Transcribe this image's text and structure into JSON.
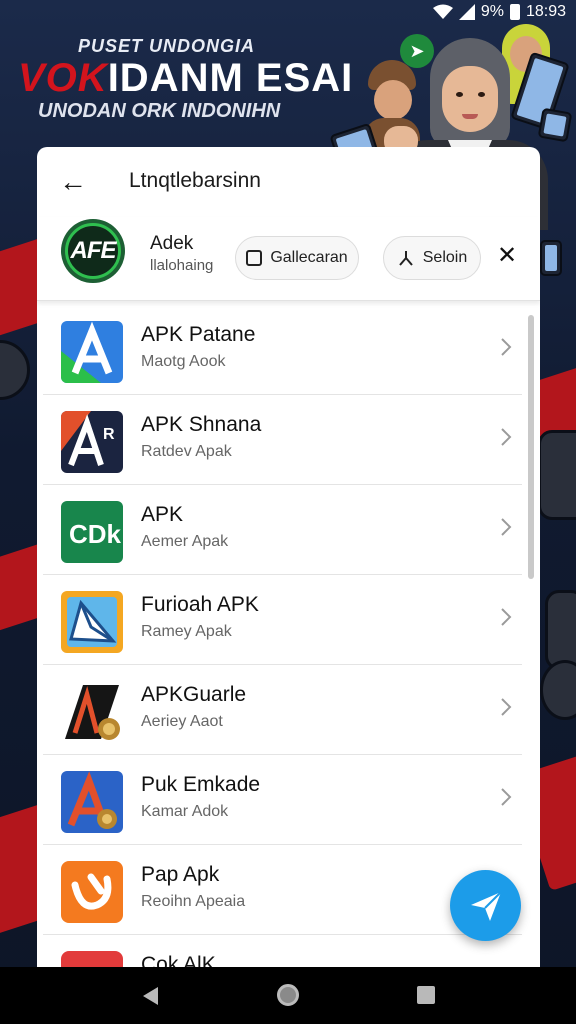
{
  "status": {
    "battery": "9%",
    "time": "18:93"
  },
  "banner": {
    "line1": "PUSET UNDONGIA",
    "line2_red": "VOK",
    "line2_white": "IDANM ESAI",
    "line3": "UNODAN ORK INDONIHN"
  },
  "header": {
    "title": "Ltnqtlebarsinn"
  },
  "app": {
    "logo_text": "AFE",
    "name": "Adek",
    "subtitle": "llalohaing",
    "button1_label": "Gallecaran",
    "button2_label": "Seloin"
  },
  "list": [
    {
      "title": "APK  Patane",
      "subtitle": "Maotg Aook",
      "icon": "apk-a-green-icon"
    },
    {
      "title": "APK  Shnana",
      "subtitle": "Ratdev Apak",
      "icon": "apk-ak-dark-icon"
    },
    {
      "title": "APK",
      "subtitle": "Aemer Apak",
      "icon": "apk-cdk-green-icon"
    },
    {
      "title": "Furioah APK",
      "subtitle": "Ramey Apak",
      "icon": "apk-envelope-icon"
    },
    {
      "title": "APKGuarle",
      "subtitle": "Aeriey Aaot",
      "icon": "apk-guard-icon"
    },
    {
      "title": "Puk Emkade",
      "subtitle": "Kamar Adok",
      "icon": "apk-blue-a-icon"
    },
    {
      "title": "Pap Apk",
      "subtitle": "Reoihn Apeaia",
      "icon": "apk-orange-icon"
    },
    {
      "title": "Cok AlK",
      "subtitle": "",
      "icon": "apk-red-icon"
    }
  ],
  "colors": {
    "fab": "#1c9ce9",
    "accent_red": "#d3141d"
  }
}
